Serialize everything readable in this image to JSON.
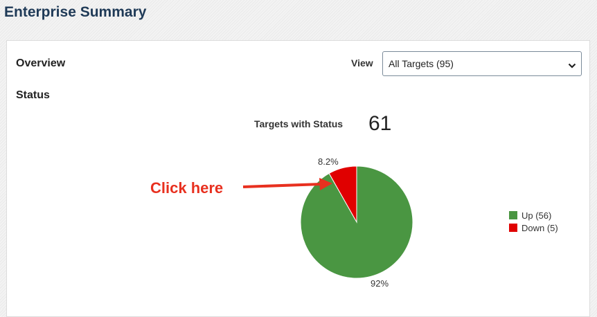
{
  "page": {
    "title": "Enterprise Summary"
  },
  "overview": {
    "label": "Overview",
    "view_label": "View",
    "view_select": {
      "value": "All Targets (95)",
      "icon": "chevron-down-icon"
    }
  },
  "status": {
    "label": "Status",
    "targets_with_status_label": "Targets with Status",
    "targets_with_status_count": "61"
  },
  "chart_data": {
    "type": "pie",
    "slices": [
      {
        "label": "Up (56)",
        "value": 56,
        "percent_label": "92%",
        "color": "#4a9642"
      },
      {
        "label": "Down (5)",
        "value": 5,
        "percent_label": "8.2%",
        "color": "#e00000"
      }
    ],
    "legend_position": "right"
  },
  "annotation": {
    "text": "Click here",
    "color": "#e8301f"
  }
}
